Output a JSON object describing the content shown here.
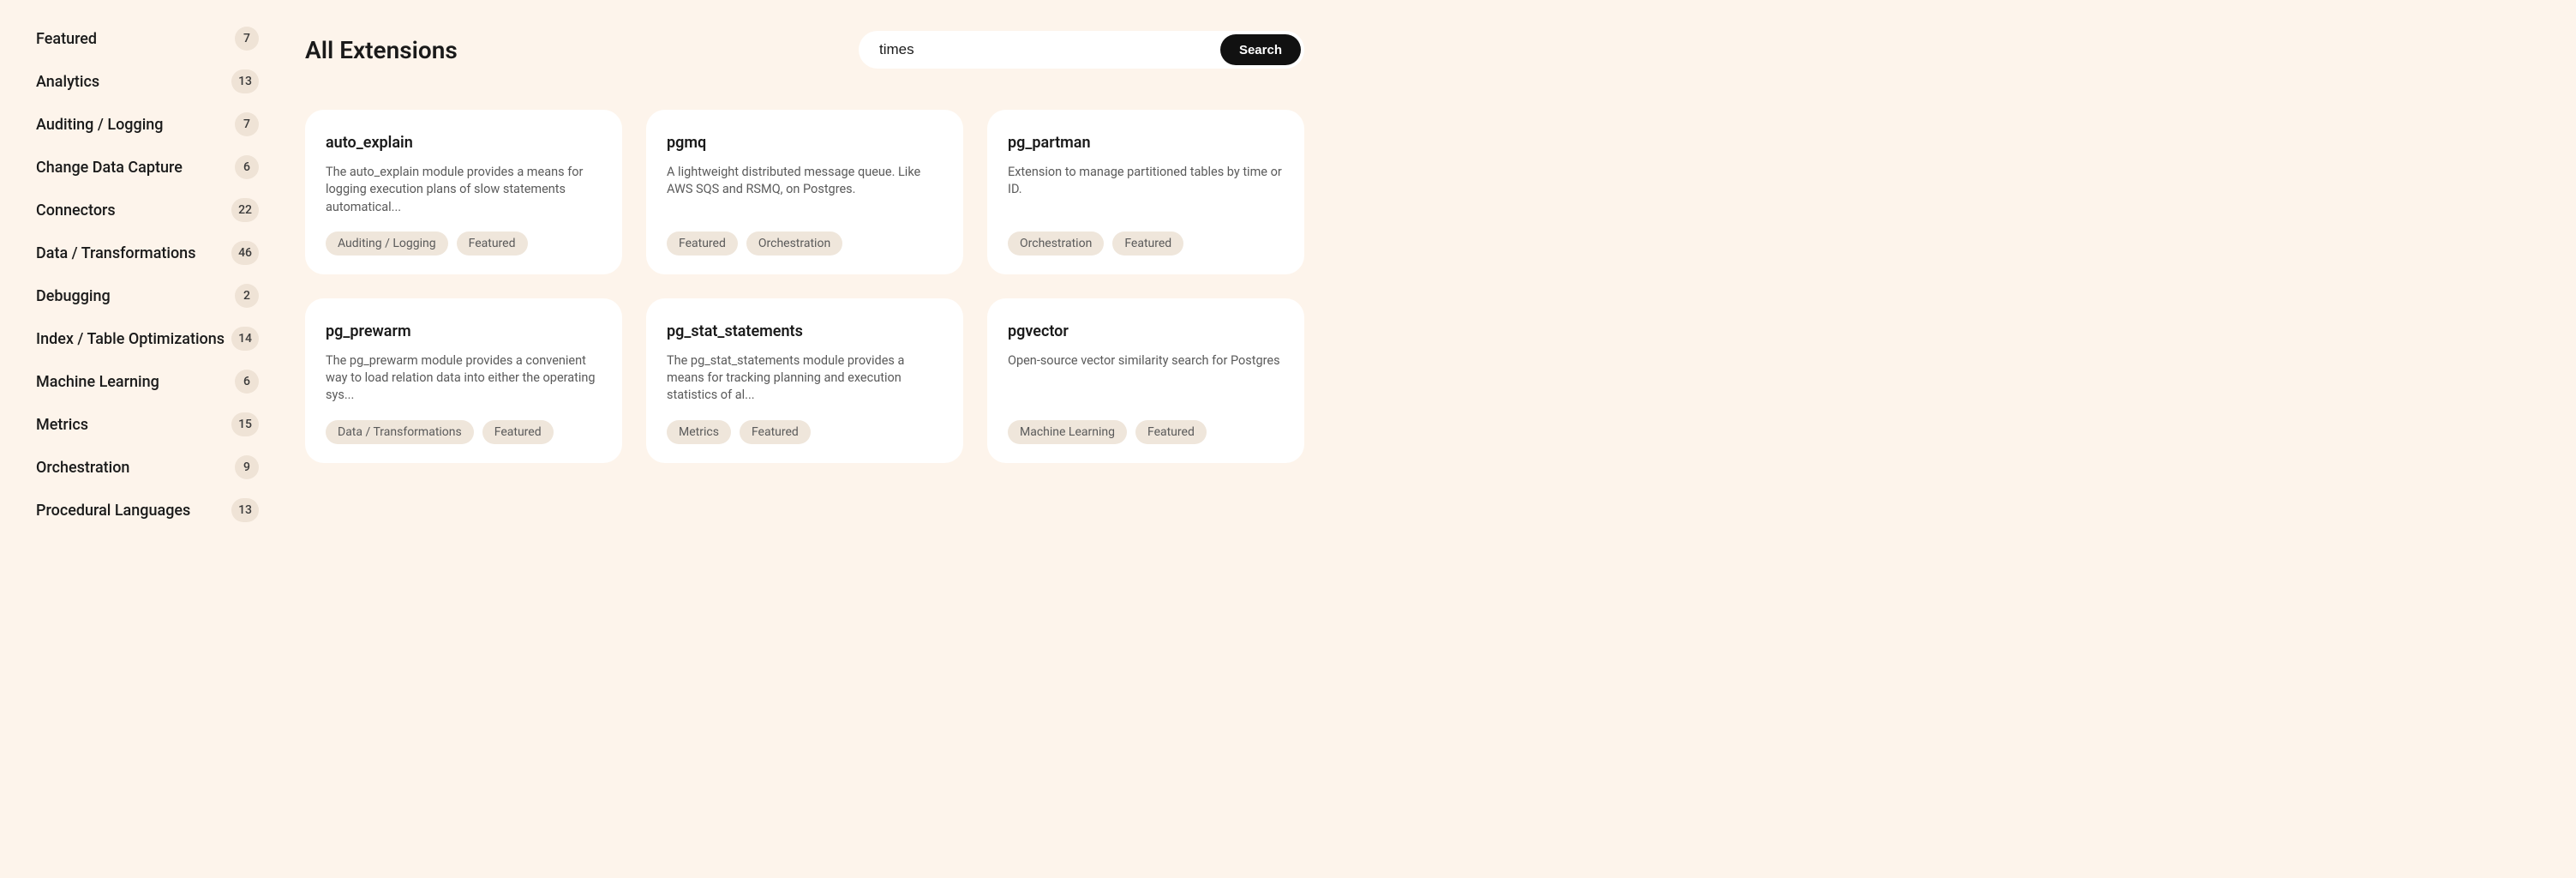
{
  "sidebar": {
    "items": [
      {
        "label": "Featured",
        "count": "7"
      },
      {
        "label": "Analytics",
        "count": "13"
      },
      {
        "label": "Auditing / Logging",
        "count": "7"
      },
      {
        "label": "Change Data Capture",
        "count": "6"
      },
      {
        "label": "Connectors",
        "count": "22"
      },
      {
        "label": "Data / Transformations",
        "count": "46"
      },
      {
        "label": "Debugging",
        "count": "2"
      },
      {
        "label": "Index / Table Optimizations",
        "count": "14"
      },
      {
        "label": "Machine Learning",
        "count": "6"
      },
      {
        "label": "Metrics",
        "count": "15"
      },
      {
        "label": "Orchestration",
        "count": "9"
      },
      {
        "label": "Procedural Languages",
        "count": "13"
      }
    ]
  },
  "header": {
    "title": "All Extensions"
  },
  "search": {
    "value": "times",
    "button_label": "Search"
  },
  "cards": [
    {
      "title": "auto_explain",
      "desc": "The auto_explain module provides a means for logging execution plans of slow statements automatical...",
      "tags": [
        "Auditing / Logging",
        "Featured"
      ]
    },
    {
      "title": "pgmq",
      "desc": "A lightweight distributed message queue. Like AWS SQS and RSMQ, on Postgres.",
      "tags": [
        "Featured",
        "Orchestration"
      ]
    },
    {
      "title": "pg_partman",
      "desc": "Extension to manage partitioned tables by time or ID.",
      "tags": [
        "Orchestration",
        "Featured"
      ]
    },
    {
      "title": "pg_prewarm",
      "desc": "The pg_prewarm module provides a convenient way to load relation data into either the operating sys...",
      "tags": [
        "Data / Transformations",
        "Featured"
      ]
    },
    {
      "title": "pg_stat_statements",
      "desc": "The pg_stat_statements module provides a means for tracking planning and execution statistics of al...",
      "tags": [
        "Metrics",
        "Featured"
      ]
    },
    {
      "title": "pgvector",
      "desc": "Open-source vector similarity search for Postgres",
      "tags": [
        "Machine Learning",
        "Featured"
      ]
    }
  ]
}
